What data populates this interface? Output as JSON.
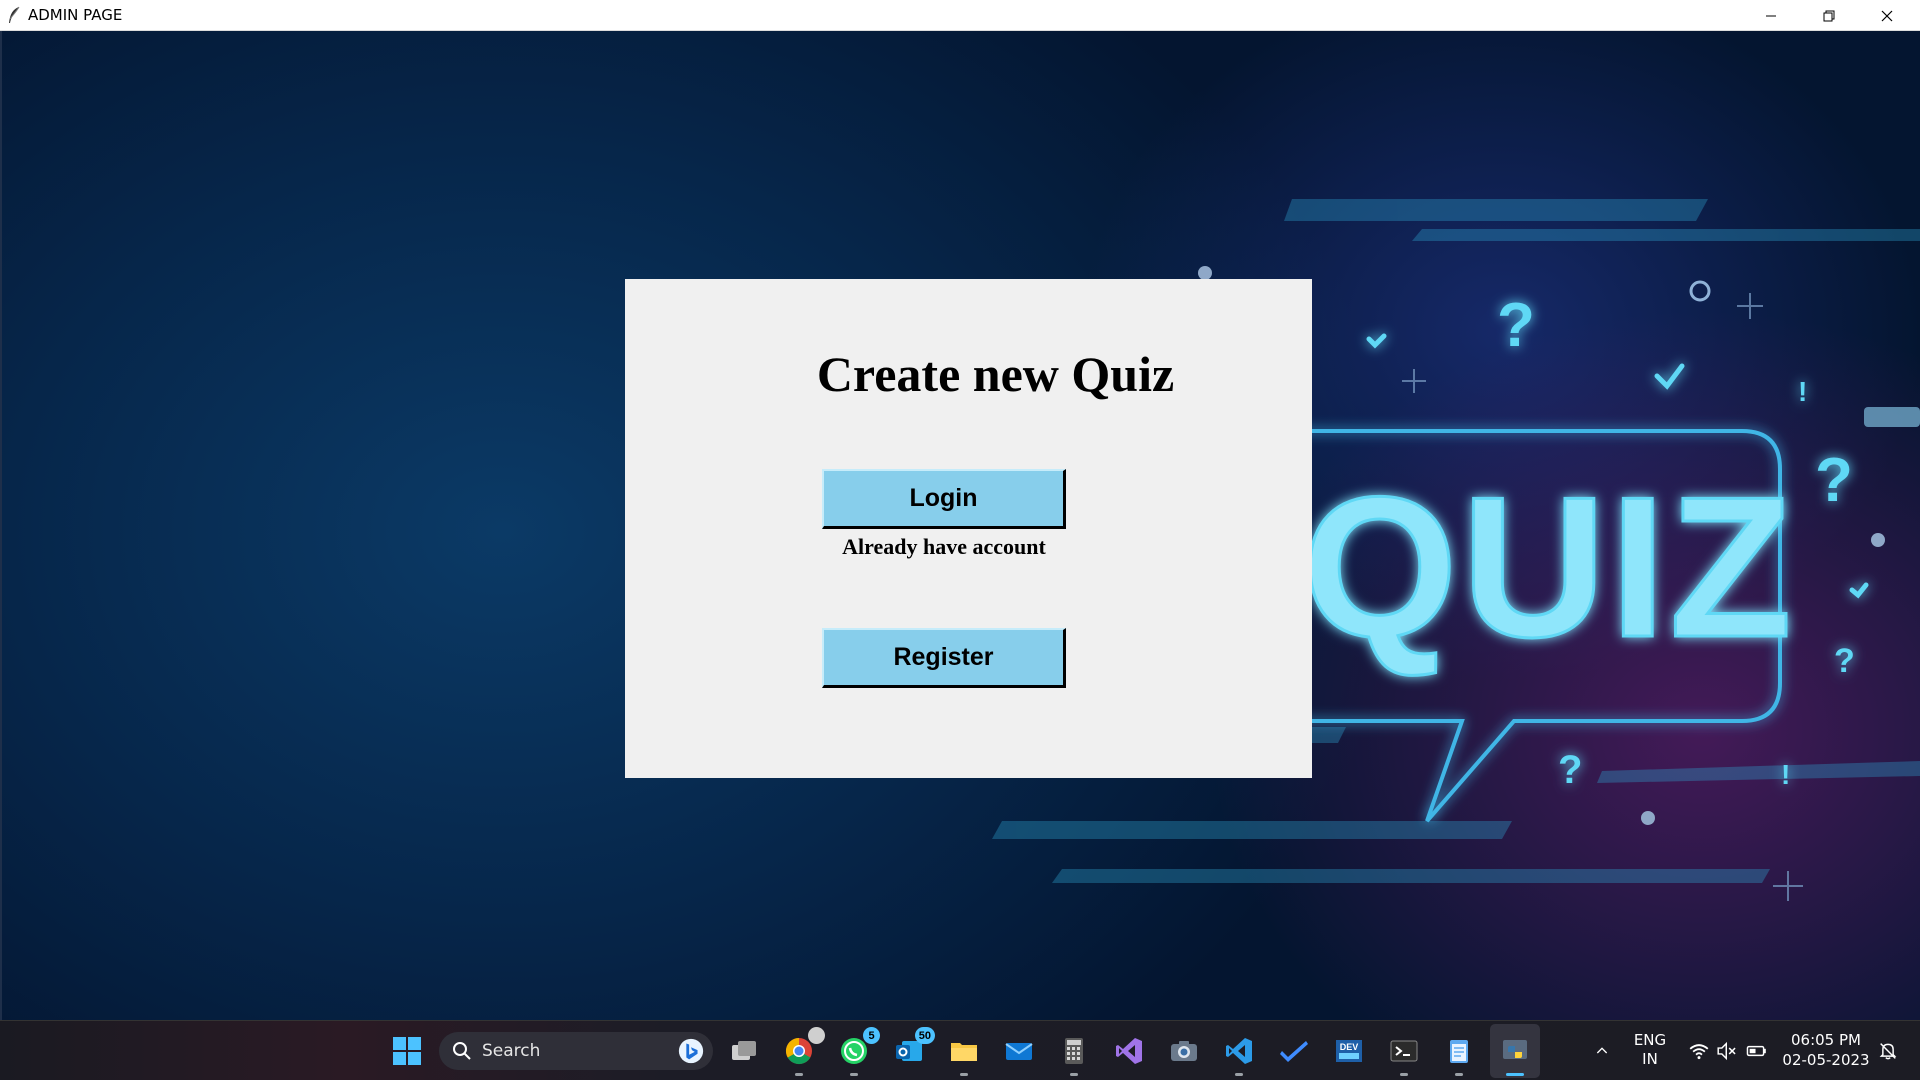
{
  "window": {
    "title": "ADMIN PAGE",
    "controls": [
      "minimize-icon",
      "restore-icon",
      "close-icon"
    ]
  },
  "background": {
    "banner_text": "QUIZ",
    "accent_color": "#5fd8f5"
  },
  "dialog": {
    "heading": "Create new Quiz",
    "login_label": "Login",
    "login_hint": "Already have account",
    "register_label": "Register",
    "button_color": "#87ceeb",
    "panel_color": "#f0f0f0"
  },
  "taskbar": {
    "search_placeholder": "Search",
    "apps": [
      {
        "name": "start-icon"
      },
      {
        "name": "bing-icon"
      },
      {
        "name": "task-view-icon"
      },
      {
        "name": "chrome-icon",
        "badge": ""
      },
      {
        "name": "whatsapp-icon",
        "badge": "5"
      },
      {
        "name": "outlook-icon",
        "badge": "50"
      },
      {
        "name": "file-explorer-icon"
      },
      {
        "name": "mail-icon"
      },
      {
        "name": "calculator-icon"
      },
      {
        "name": "visual-studio-icon"
      },
      {
        "name": "camera-icon"
      },
      {
        "name": "vscode-icon"
      },
      {
        "name": "todo-icon"
      },
      {
        "name": "devcpp-icon",
        "label": "DEV"
      },
      {
        "name": "terminal-icon"
      },
      {
        "name": "notepad-icon"
      },
      {
        "name": "python-icon"
      }
    ],
    "badges": {
      "whatsapp": "5",
      "outlook": "50"
    },
    "dev_label": "DEV",
    "tray": {
      "language": "ENG",
      "region": "IN",
      "time": "06:05 PM",
      "date": "02-05-2023"
    }
  }
}
